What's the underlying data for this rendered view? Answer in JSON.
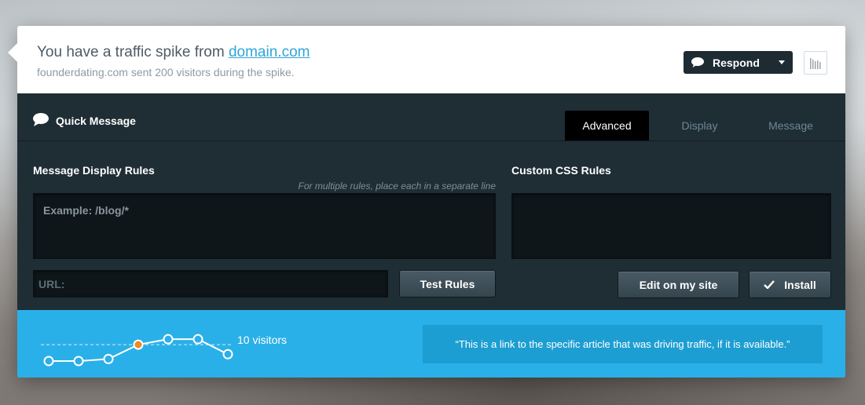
{
  "header": {
    "title_prefix": "You have a traffic spike from",
    "title_link": "domain.com",
    "subtitle": "founderdating.com sent 200 visitors during the spike.",
    "respond_label": "Respond",
    "respond_icon": "speech-bubble-icon",
    "stats_icon": "bar-chart-icon"
  },
  "panel": {
    "title": "Quick Message",
    "title_icon": "speech-bubble-icon",
    "tabs": [
      {
        "label": "Advanced",
        "active": true
      },
      {
        "label": "Display",
        "active": false
      },
      {
        "label": "Message",
        "active": false
      }
    ],
    "rules": {
      "label": "Message Display Rules",
      "hint": "For multiple rules, place each in a separate line",
      "placeholder": "Example: /blog/*",
      "url_placeholder": "URL:",
      "test_label": "Test Rules"
    },
    "css": {
      "label": "Custom CSS Rules",
      "edit_label": "Edit on my site",
      "install_label": "Install",
      "install_icon": "checkmark-icon"
    }
  },
  "footer": {
    "visitors_label": "10 visitors",
    "quote": "“This is a link to the specific article that was driving traffic, if it is available.”",
    "sparkline_values": [
      1,
      1,
      1.3,
      3.4,
      4.2,
      4.2,
      2
    ],
    "highlight_index": 3
  },
  "colors": {
    "accent": "#2ab0e8",
    "dark_panel": "#1f2d35",
    "link": "#2fa5d8",
    "highlight_point": "#f08a1f"
  }
}
